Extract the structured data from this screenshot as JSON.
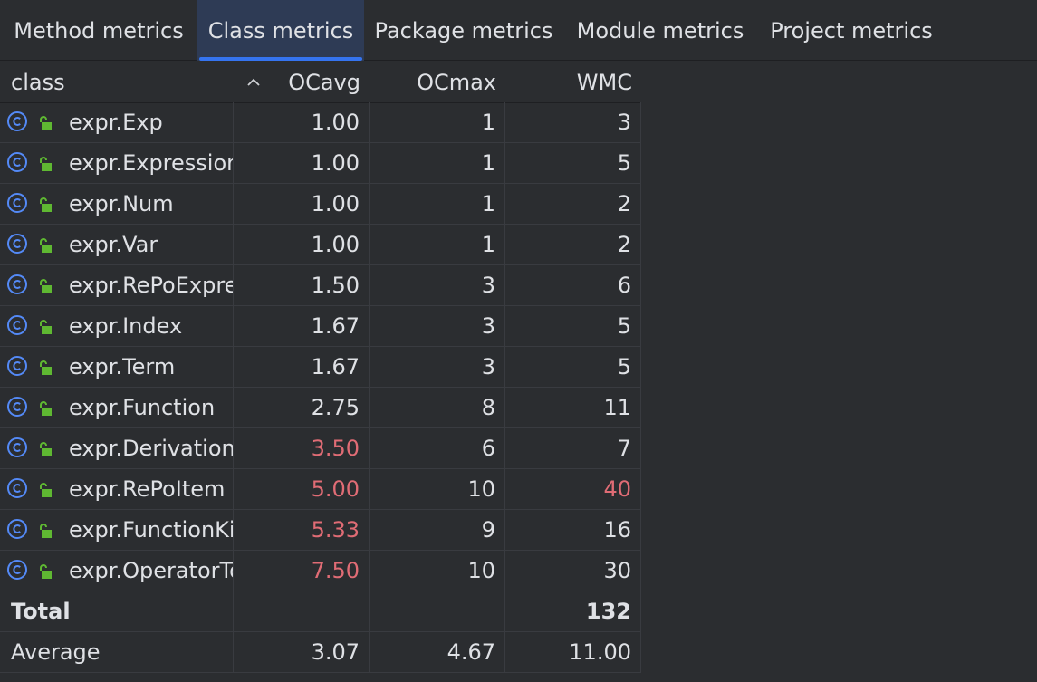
{
  "tabs": [
    {
      "label": "Method metrics"
    },
    {
      "label": "Class metrics"
    },
    {
      "label": "Package metrics"
    },
    {
      "label": "Module metrics"
    },
    {
      "label": "Project metrics"
    }
  ],
  "active_tab": "Class metrics",
  "columns": [
    {
      "label": "class"
    },
    {
      "label": "OCavg"
    },
    {
      "label": "OCmax"
    },
    {
      "label": "WMC"
    }
  ],
  "sort_indicator": "^",
  "rows": [
    {
      "name": "expr.Exp",
      "ocavg": "1.00",
      "ocmax": "1",
      "wmc": "3",
      "ocavg_bad": false,
      "wmc_bad": false
    },
    {
      "name": "expr.Expression",
      "ocavg": "1.00",
      "ocmax": "1",
      "wmc": "5",
      "ocavg_bad": false,
      "wmc_bad": false
    },
    {
      "name": "expr.Num",
      "ocavg": "1.00",
      "ocmax": "1",
      "wmc": "2",
      "ocavg_bad": false,
      "wmc_bad": false
    },
    {
      "name": "expr.Var",
      "ocavg": "1.00",
      "ocmax": "1",
      "wmc": "2",
      "ocavg_bad": false,
      "wmc_bad": false
    },
    {
      "name": "expr.RePoExpres",
      "ocavg": "1.50",
      "ocmax": "3",
      "wmc": "6",
      "ocavg_bad": false,
      "wmc_bad": false
    },
    {
      "name": "expr.Index",
      "ocavg": "1.67",
      "ocmax": "3",
      "wmc": "5",
      "ocavg_bad": false,
      "wmc_bad": false
    },
    {
      "name": "expr.Term",
      "ocavg": "1.67",
      "ocmax": "3",
      "wmc": "5",
      "ocavg_bad": false,
      "wmc_bad": false
    },
    {
      "name": "expr.Function",
      "ocavg": "2.75",
      "ocmax": "8",
      "wmc": "11",
      "ocavg_bad": false,
      "wmc_bad": false
    },
    {
      "name": "expr.DerivationK",
      "ocavg": "3.50",
      "ocmax": "6",
      "wmc": "7",
      "ocavg_bad": true,
      "wmc_bad": false
    },
    {
      "name": "expr.RePoItem",
      "ocavg": "5.00",
      "ocmax": "10",
      "wmc": "40",
      "ocavg_bad": true,
      "wmc_bad": true
    },
    {
      "name": "expr.FunctionKil",
      "ocavg": "5.33",
      "ocmax": "9",
      "wmc": "16",
      "ocavg_bad": true,
      "wmc_bad": false
    },
    {
      "name": "expr.OperatorTo",
      "ocavg": "7.50",
      "ocmax": "10",
      "wmc": "30",
      "ocavg_bad": true,
      "wmc_bad": false
    }
  ],
  "total": {
    "label": "Total",
    "ocavg": "",
    "ocmax": "",
    "wmc": "132"
  },
  "average": {
    "label": "Average",
    "ocavg": "3.07",
    "ocmax": "4.67",
    "wmc": "11.00"
  },
  "colors": {
    "background": "#2b2d30",
    "active_tab_bg": "#2e3b55",
    "active_tab_underline": "#3574f0",
    "text": "#dfe1e5",
    "warning_text": "#e06c75",
    "class_icon": "#548af7",
    "lock_icon": "#5fb832"
  },
  "icons": {
    "class": "class-icon",
    "access": "unlocked-padlock-icon"
  }
}
